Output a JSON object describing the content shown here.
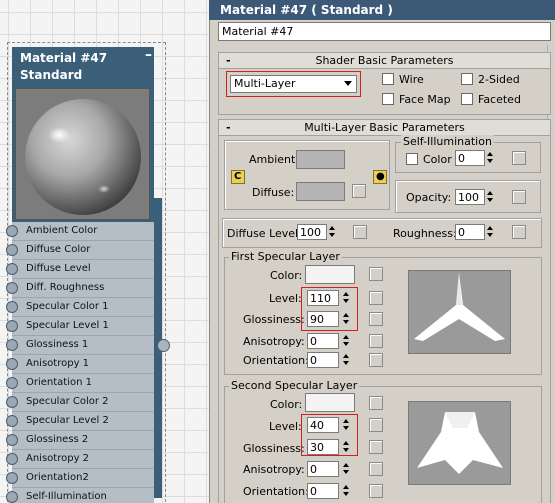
{
  "node": {
    "title": "Material #47",
    "subtitle": "Standard",
    "minimize": "–",
    "slots": [
      "Ambient Color",
      "Diffuse Color",
      "Diffuse Level",
      "Diff. Roughness",
      "Specular Color 1",
      "Specular Level 1",
      "Glossiness 1",
      "Anisotropy 1",
      "Orientation 1",
      "Specular Color 2",
      "Specular Level 2",
      "Glossiness 2",
      "Anisotropy 2",
      "Orientation2",
      "Self-Illumination"
    ]
  },
  "panel": {
    "title": "Material #47  ( Standard )",
    "name_value": "Material #47",
    "shader_rollout": {
      "title": "Shader Basic Parameters",
      "collapse": "-",
      "shader_type": "Multi-Layer",
      "wire": "Wire",
      "two_sided": "2-Sided",
      "face_map": "Face Map",
      "faceted": "Faceted"
    },
    "ml_rollout": {
      "title": "Multi-Layer Basic Parameters",
      "collapse": "-",
      "ambient": "Ambient:",
      "diffuse": "Diffuse:",
      "lock": "C",
      "self_illum_title": "Self-Illumination",
      "color": "Color",
      "self_illum_value": "0",
      "opacity": "Opacity:",
      "opacity_value": "100",
      "diffuse_level": "Diffuse Level:",
      "diffuse_level_value": "100",
      "roughness": "Roughness:",
      "roughness_value": "0"
    },
    "first_layer": {
      "title": "First Specular Layer",
      "color": "Color:",
      "level": "Level:",
      "level_value": "110",
      "glossiness": "Glossiness:",
      "glossiness_value": "90",
      "anisotropy": "Anisotropy:",
      "anisotropy_value": "0",
      "orientation": "Orientation:",
      "orientation_value": "0"
    },
    "second_layer": {
      "title": "Second Specular Layer",
      "color": "Color:",
      "level": "Level:",
      "level_value": "40",
      "glossiness": "Glossiness:",
      "glossiness_value": "30",
      "anisotropy": "Anisotropy:",
      "anisotropy_value": "0",
      "orientation": "Orientation:",
      "orientation_value": "0"
    }
  },
  "colors": {
    "node_header": "#3c5f79",
    "panel_title": "#3c5a78",
    "highlight_box": "#d02020",
    "ambient_swatch": "#b4b4b4",
    "diffuse_swatch": "#b4b4b4",
    "specular_swatch": "#f4f4f4"
  }
}
